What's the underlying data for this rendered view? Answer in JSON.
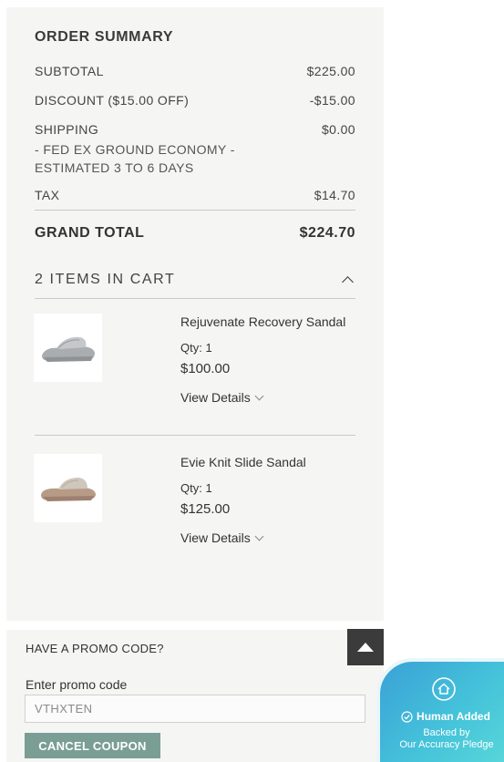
{
  "summary": {
    "title": "ORDER SUMMARY",
    "subtotal_label": "SUBTOTAL",
    "subtotal_value": "$225.00",
    "discount_label": "DISCOUNT ($15.00 OFF)",
    "discount_value": "-$15.00",
    "shipping_label": "SHIPPING",
    "shipping_method": "- FED EX GROUND ECONOMY - ESTIMATED 3 TO 6 DAYS",
    "shipping_value": "$0.00",
    "tax_label": "TAX",
    "tax_value": "$14.70",
    "grand_total_label": "GRAND TOTAL",
    "grand_total_value": "$224.70"
  },
  "cart": {
    "header": "2 ITEMS IN CART",
    "items": [
      {
        "name": "Rejuvenate Recovery Sandal",
        "qty": "Qty: 1",
        "price": "$100.00",
        "details_label": "View Details",
        "color": "#b9bdbf"
      },
      {
        "name": "Evie Knit Slide Sandal",
        "qty": "Qty: 1",
        "price": "$125.00",
        "details_label": "View Details",
        "color": "#c8b9a9"
      }
    ]
  },
  "promo": {
    "title": "HAVE A PROMO CODE?",
    "input_label": "Enter promo code",
    "input_value": "VTHXTEN",
    "cancel_button": "CANCEL COUPON"
  },
  "badge": {
    "title": "Human Added",
    "subtitle_line1": "Backed by",
    "subtitle_line2": "Our Accuracy Pledge"
  },
  "colors": {
    "panel_bg": "#f5f5f4",
    "button_accent": "#7a9e94",
    "scroll_button": "#3b3b3b",
    "badge_gradient_start": "#3aa1d6",
    "badge_gradient_end": "#5ad8da"
  },
  "icons": {
    "cart_toggle": "chevron-up-icon",
    "details_toggle": "chevron-down-icon",
    "scroll_top": "triangle-up-icon",
    "badge": "house-circle-icon",
    "badge_check": "check-circle-icon"
  }
}
